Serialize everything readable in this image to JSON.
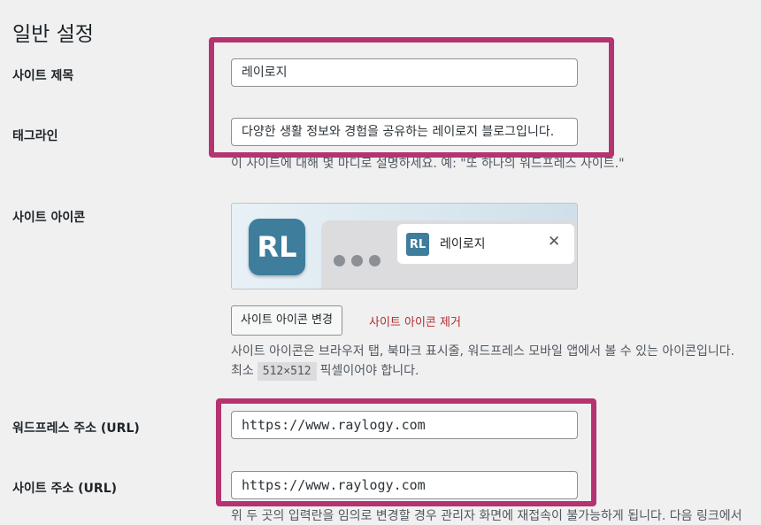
{
  "page": {
    "title": "일반 설정"
  },
  "site_title": {
    "label": "사이트 제목",
    "value": "레이로지"
  },
  "tagline": {
    "label": "태그라인",
    "value": "다양한 생활 정보와 경험을 공유하는 레이로지 블로그입니다.",
    "description": "이 사이트에 대해 몇 마디로 설명하세요. 예: \"또 하나의 워드프레스 사이트.\""
  },
  "site_icon": {
    "label": "사이트 아이콘",
    "app_icon_text": "RL",
    "tab_icon_text": "RL",
    "tab_title": "레이로지",
    "tab_close": "✕",
    "change_button": "사이트 아이콘 변경",
    "remove_link": "사이트 아이콘 제거",
    "description_line1": "사이트 아이콘은 브라우저 탭, 북마크 표시줄, 워드프레스 모바일 앱에서 볼 수 있는 아이콘입니다.",
    "description_line2_prefix": "최소",
    "description_size": "512×512",
    "description_line2_suffix": "픽셀이어야 합니다."
  },
  "wp_address": {
    "label": "워드프레스 주소 (URL)",
    "value": "https://www.raylogy.com"
  },
  "site_address": {
    "label": "사이트 주소 (URL)",
    "value": "https://www.raylogy.com",
    "description": "위 두 곳의 입력란을 임의로 변경할 경우 관리자 화면에 재접속이 불가능하게 됩니다. 다음 링크에서"
  },
  "colors": {
    "highlight": "#b5336f",
    "brand_icon": "#3e7d9b",
    "remove_link": "#b32d2e"
  }
}
